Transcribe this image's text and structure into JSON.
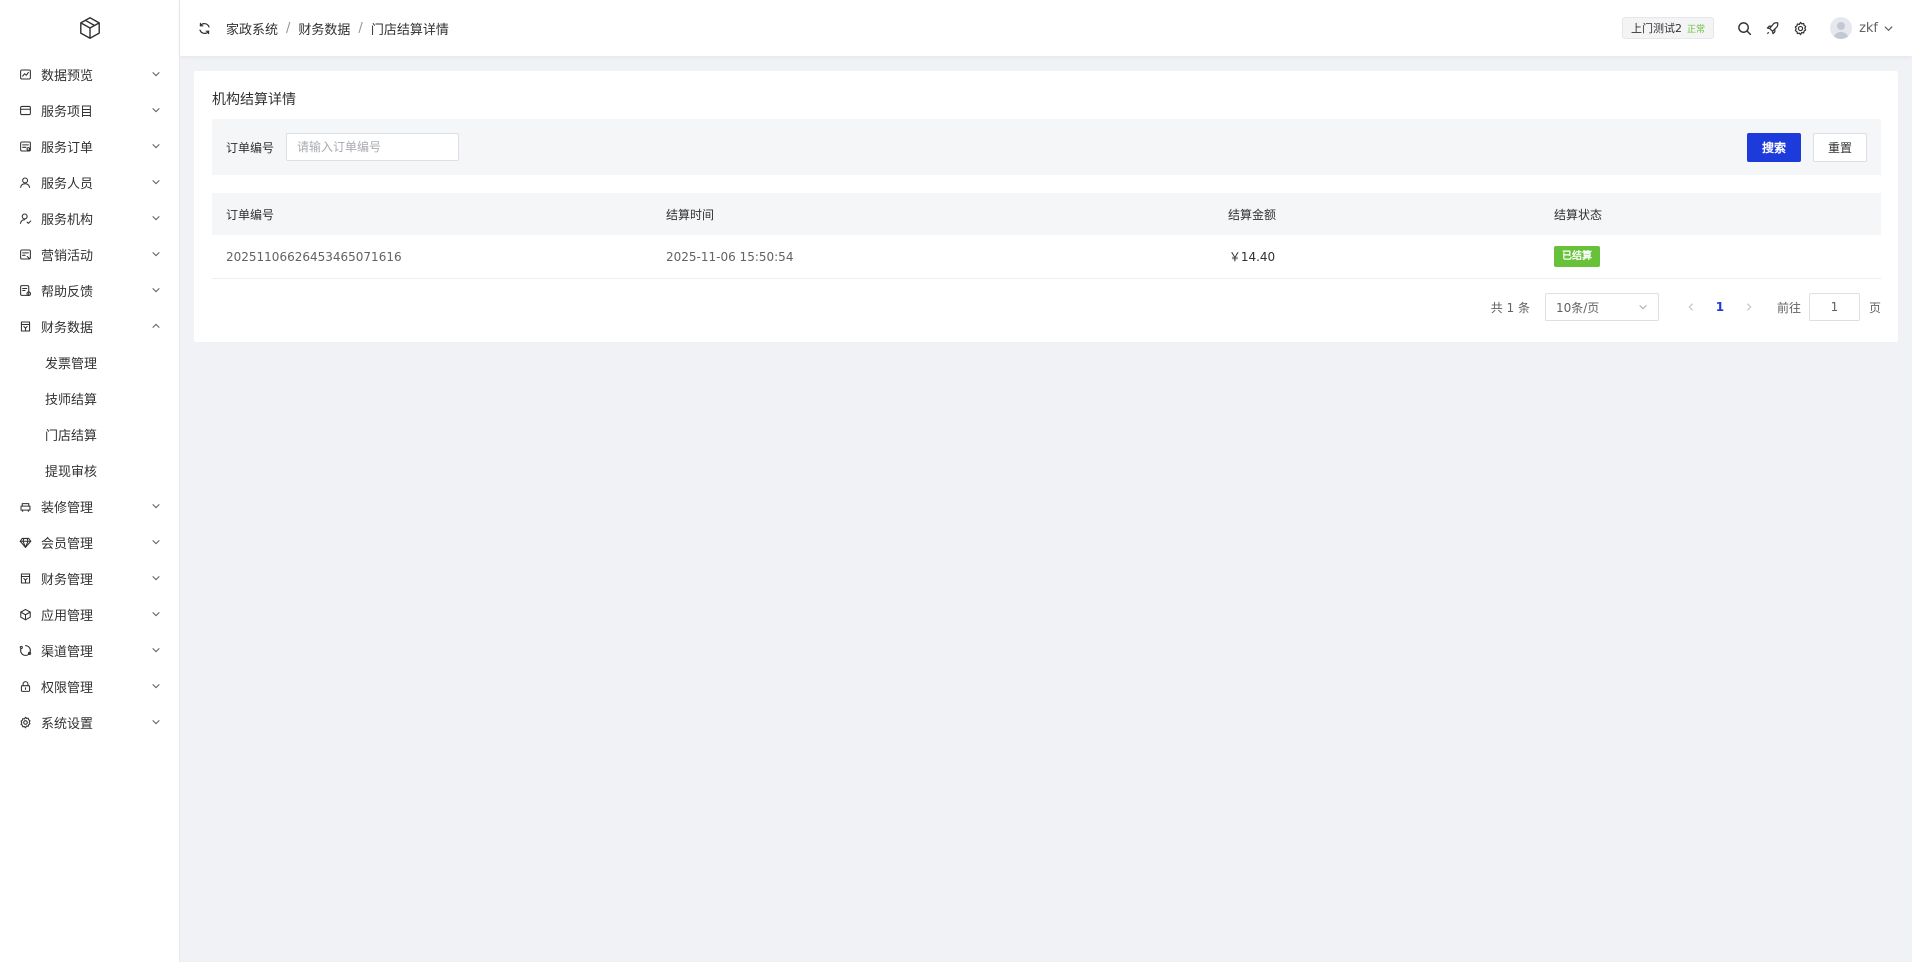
{
  "sidebar": {
    "items": [
      {
        "label": "数据预览",
        "icon": "chart-icon"
      },
      {
        "label": "服务项目",
        "icon": "wallet-icon"
      },
      {
        "label": "服务订单",
        "icon": "order-icon"
      },
      {
        "label": "服务人员",
        "icon": "user-icon"
      },
      {
        "label": "服务机构",
        "icon": "org-icon"
      },
      {
        "label": "营销活动",
        "icon": "marketing-icon"
      },
      {
        "label": "帮助反馈",
        "icon": "feedback-icon"
      },
      {
        "label": "财务数据",
        "icon": "finance-icon",
        "expanded": true
      },
      {
        "label": "装修管理",
        "icon": "decor-icon"
      },
      {
        "label": "会员管理",
        "icon": "diamond-icon"
      },
      {
        "label": "财务管理",
        "icon": "finance-icon"
      },
      {
        "label": "应用管理",
        "icon": "cube-icon"
      },
      {
        "label": "渠道管理",
        "icon": "channel-icon"
      },
      {
        "label": "权限管理",
        "icon": "lock-icon"
      },
      {
        "label": "系统设置",
        "icon": "gear-icon"
      }
    ],
    "finance_sub": [
      "发票管理",
      "技师结算",
      "门店结算",
      "提现审核"
    ]
  },
  "header": {
    "breadcrumb": [
      "家政系统",
      "财务数据",
      "门店结算详情"
    ],
    "shop_name": "上门测试2",
    "shop_status": "正常",
    "username": "zkf"
  },
  "page": {
    "title": "机构结算详情",
    "search": {
      "label": "订单编号",
      "placeholder": "请输入订单编号",
      "search_btn": "搜索",
      "reset_btn": "重置"
    },
    "table": {
      "columns": [
        "订单编号",
        "结算时间",
        "结算金额",
        "结算状态"
      ],
      "rows": [
        {
          "order_no": "20251106626453465071616",
          "time": "2025-11-06 15:50:54",
          "amount": "￥14.40",
          "status": "已结算"
        }
      ]
    },
    "pagination": {
      "total": "共 1 条",
      "page_size": "10条/页",
      "current": "1",
      "goto_label": "前往",
      "goto_value": "1",
      "goto_suffix": "页"
    }
  },
  "colors": {
    "primary": "#1d3adb",
    "success": "#67c23a"
  }
}
